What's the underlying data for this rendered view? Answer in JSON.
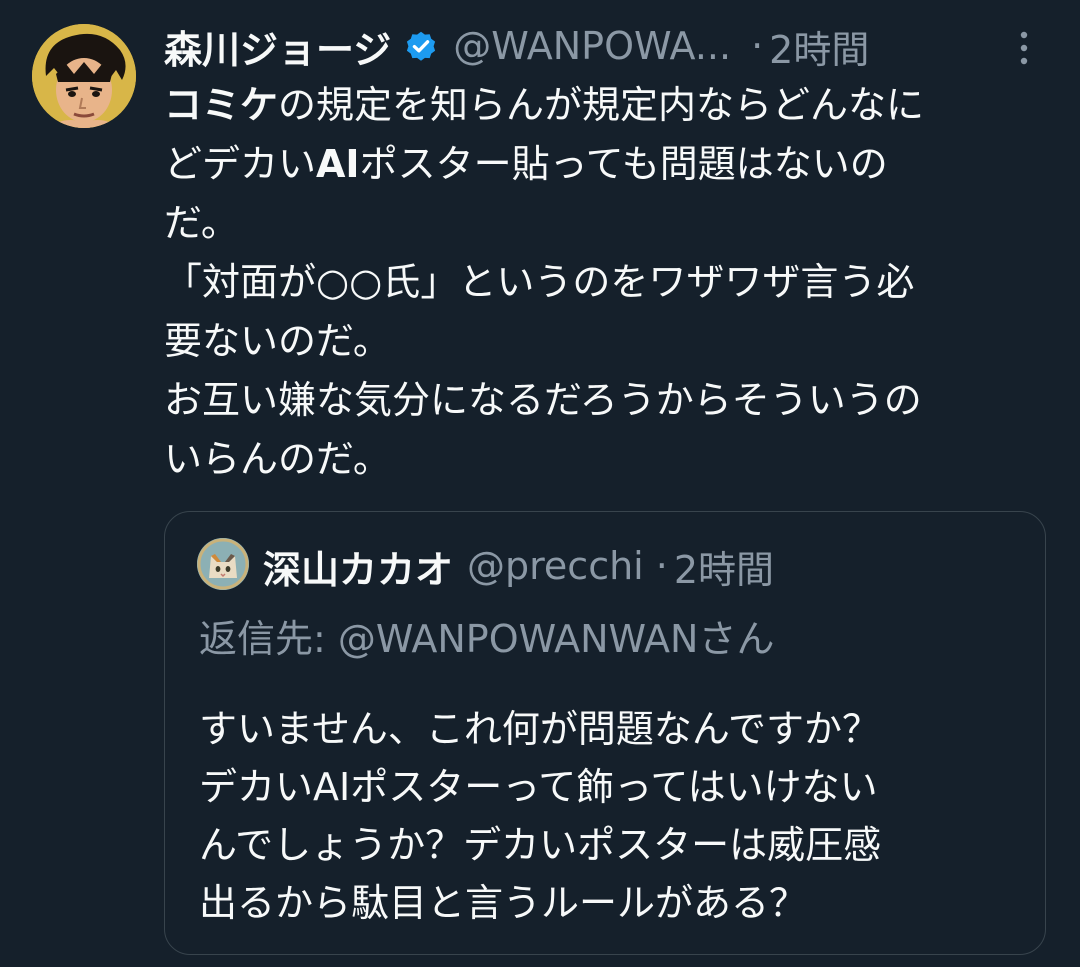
{
  "tweet": {
    "author": {
      "display_name": "森川ジョージ",
      "handle": "@WANPOWA...",
      "verified": true,
      "avatar_icon": "anime-boxer-avatar"
    },
    "separator": "·",
    "time": "2時間",
    "more_icon": "more-vertical-icon",
    "body_lines": [
      {
        "bold": "コミケ",
        "text": "の規定を知らんが規定内ならどんなに"
      },
      {
        "bold": "",
        "text": "どデカい"
      },
      {
        "bold": "",
        "text": "だ。"
      },
      {
        "bold": "",
        "text": "「対面が○○氏」というのをワザワザ言う必"
      },
      {
        "bold": "",
        "text": "要ないのだ。"
      },
      {
        "bold": "",
        "text": "お互い嫌な気分になるだろうからそういうの"
      },
      {
        "bold": "",
        "text": "いらんのだ。"
      }
    ],
    "body_line2_bold": "AI",
    "body_line2_rest": "ポスター貼っても問題はないの",
    "quoted": {
      "author": {
        "display_name": "深山カカオ",
        "handle": "@precchi",
        "avatar_icon": "cat-avatar"
      },
      "separator": "·",
      "time": "2時間",
      "reply_to": "返信先: @WANPOWANWANさん",
      "body_lines": [
        "すいません、これ何が問題なんですか？",
        "デカいAIポスターって飾ってはいけない",
        "んでしょうか？デカいポスターは威圧感",
        "出るから駄目と言うルールがある？"
      ]
    }
  },
  "colors": {
    "background": "#15202b",
    "text_primary": "#f7f9f9",
    "text_secondary": "#8b98a5",
    "border": "#38444d",
    "verified": "#1d9bf0"
  }
}
